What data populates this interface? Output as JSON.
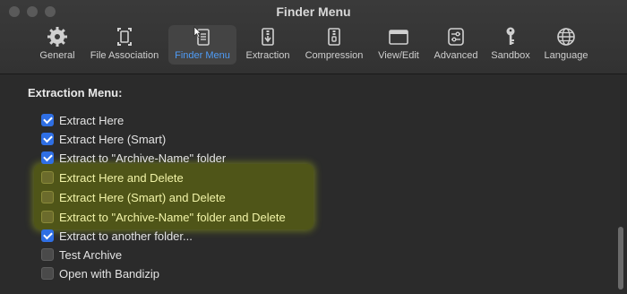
{
  "window": {
    "title": "Finder Menu"
  },
  "toolbar": {
    "items": [
      {
        "label": "General",
        "icon": "gear-icon"
      },
      {
        "label": "File Association",
        "icon": "file-association-icon"
      },
      {
        "label": "Finder Menu",
        "icon": "finder-menu-icon",
        "active": true
      },
      {
        "label": "Extraction",
        "icon": "extraction-icon"
      },
      {
        "label": "Compression",
        "icon": "compression-icon"
      },
      {
        "label": "View/Edit",
        "icon": "window-icon"
      },
      {
        "label": "Advanced",
        "icon": "advanced-icon"
      },
      {
        "label": "Sandbox",
        "icon": "key-icon"
      },
      {
        "label": "Language",
        "icon": "globe-icon"
      }
    ],
    "accent_color": "#4f9cf7"
  },
  "section": {
    "title": "Extraction Menu:",
    "options": [
      {
        "label": "Extract Here",
        "checked": true
      },
      {
        "label": "Extract Here (Smart)",
        "checked": true
      },
      {
        "label": "Extract to \"Archive-Name\" folder",
        "checked": true
      },
      {
        "label": "Extract Here and Delete",
        "checked": false,
        "highlighted": true
      },
      {
        "label": "Extract Here (Smart) and Delete",
        "checked": false,
        "highlighted": true
      },
      {
        "label": "Extract to \"Archive-Name\" folder and Delete",
        "checked": false,
        "highlighted": true
      },
      {
        "label": "Extract to another folder...",
        "checked": true
      },
      {
        "label": "Test Archive",
        "checked": false
      },
      {
        "label": "Open with Bandizip",
        "checked": false
      }
    ]
  }
}
